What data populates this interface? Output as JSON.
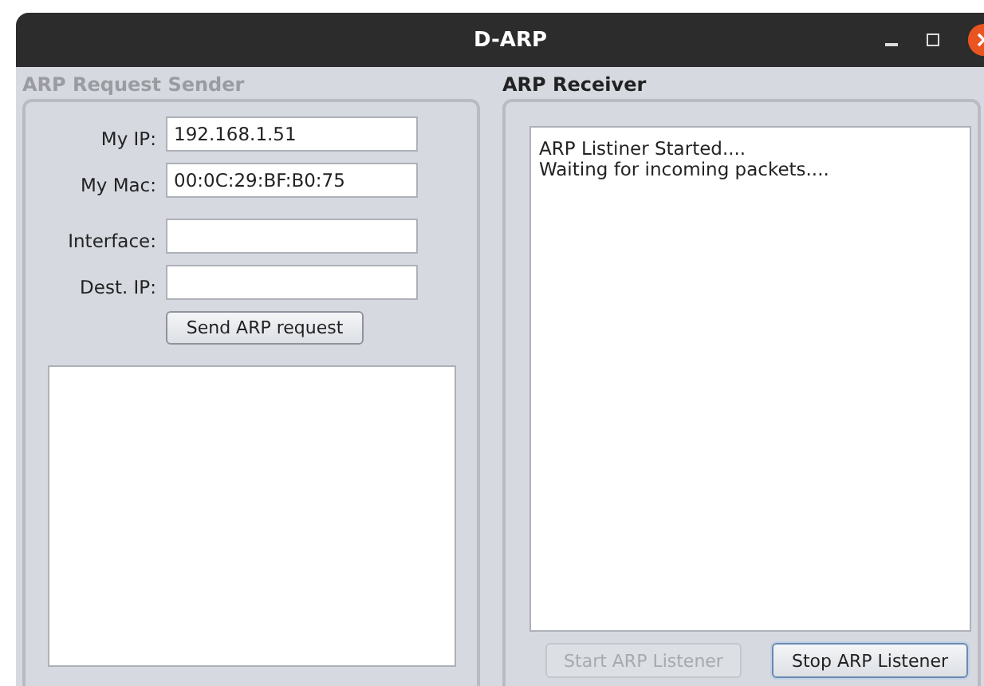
{
  "window": {
    "title": "D-ARP"
  },
  "sender": {
    "title": "ARP Request Sender",
    "disabled": true,
    "fields": [
      {
        "label": "My IP:",
        "value": "192.168.1.51"
      },
      {
        "label": "My Mac:",
        "value": "00:0C:29:BF:B0:75"
      },
      {
        "label": "Interface:"
      },
      {
        "label": "Dest. IP:"
      }
    ],
    "button": {
      "label": "Send ARP request",
      "disabled": false,
      "focused": false
    }
  },
  "receiver": {
    "title": "ARP Receiver",
    "disabled": false,
    "log": "ARP Listiner Started....\nWaiting for incoming packets....",
    "buttons": [
      {
        "label": "Start ARP Listener",
        "disabled": true,
        "focused": false
      },
      {
        "label": "Stop ARP Listener",
        "disabled": false,
        "focused": true
      }
    ]
  }
}
